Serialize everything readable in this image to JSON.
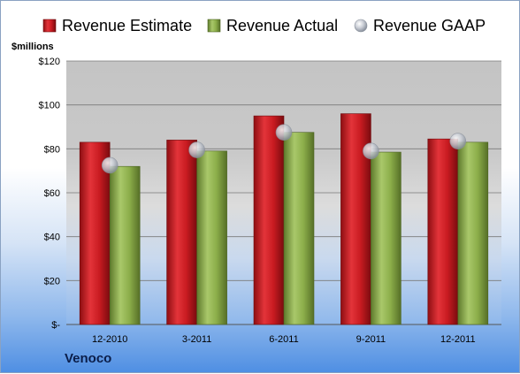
{
  "company": "Venoco",
  "chart_data": {
    "type": "bar",
    "categories": [
      "12-2010",
      "3-2011",
      "6-2011",
      "9-2011",
      "12-2011"
    ],
    "series": [
      {
        "name": "Revenue Estimate",
        "type": "bar",
        "color": "#c0161b",
        "values": [
          83,
          84,
          95,
          96,
          84.5
        ]
      },
      {
        "name": "Revenue Actual",
        "type": "bar",
        "color": "#8cae4a",
        "values": [
          72,
          79,
          87.5,
          78.5,
          83
        ]
      },
      {
        "name": "Revenue GAAP",
        "type": "marker",
        "color": "#b8bec8",
        "values": [
          72.5,
          79.5,
          87.5,
          79,
          83.5
        ]
      }
    ],
    "ylabel": "$millions",
    "ylim": [
      0,
      120
    ],
    "yticks": [
      0,
      20,
      40,
      60,
      80,
      100,
      120
    ],
    "ytick_labels": [
      "$-",
      "$20",
      "$40",
      "$60",
      "$80",
      "$100",
      "$120"
    ],
    "grid": true,
    "legend": "top"
  }
}
